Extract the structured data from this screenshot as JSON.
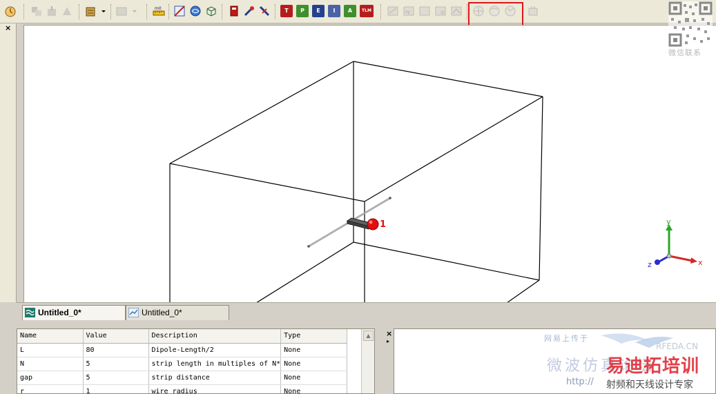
{
  "colors": {
    "toolbar_bg": "#ece9d8",
    "highlight_box": "#e0141b",
    "axis_x": "#d42828",
    "axis_y": "#2aa52a",
    "axis_z": "#2a2ad4",
    "port_marker": "#e01010"
  },
  "toolbar": {
    "icons": [
      "clock-icon",
      "frame-icon",
      "scale-icon",
      "mirror-icon",
      "stack-icon",
      "dropdown-icon",
      "window-icon",
      "dropdown-icon",
      "ruler-icon",
      "mesh-icon",
      "globe-icon",
      "cube-icon",
      "book-icon",
      "probe-icon",
      "wire-icon",
      "t-badge-icon",
      "p-badge-icon",
      "e-badge-icon",
      "i-badge-icon",
      "a-badge-icon",
      "tlm-badge-icon",
      "near-field-icon",
      "axes-icon",
      "view-icon",
      "export-icon",
      "view2-icon",
      "far-field-crosshair-icon",
      "far-field-theta-icon",
      "far-field-phi-icon",
      "results-icon"
    ],
    "badge_labels": {
      "t": "T",
      "p": "P",
      "e": "E",
      "i": "I",
      "a": "A",
      "tlm": "TLM"
    }
  },
  "viewport": {
    "port_label": "1",
    "axes": {
      "x": "x",
      "y": "y",
      "z": "z"
    }
  },
  "tabs": [
    {
      "label": "Untitled_0*",
      "active": true
    },
    {
      "label": "Untitled_0*",
      "active": false
    }
  ],
  "parameters": {
    "columns": [
      "Name",
      "Value",
      "Description",
      "Type"
    ],
    "rows": [
      {
        "name": "L",
        "value": "80",
        "description": "Dipole-Length/2",
        "type": "None"
      },
      {
        "name": "N",
        "value": "5",
        "description": "strip length in multiples of N*",
        "type": "None"
      },
      {
        "name": "gap",
        "value": "5",
        "description": "strip distance",
        "type": "None"
      },
      {
        "name": "r",
        "value": "1",
        "description": "wire radius",
        "type": "None"
      }
    ]
  },
  "watermarks": {
    "wechat": "微信联系",
    "site": "RFEDA.CN",
    "cn_top": "网易上传于",
    "cn_mid": "微波仿真论坛",
    "brand": "易迪拓培训",
    "url": "http://",
    "tagline": "射频和天线设计专家"
  },
  "close_symbol": "×",
  "pin_symbol": "▸",
  "scroll_up_symbol": "▲"
}
